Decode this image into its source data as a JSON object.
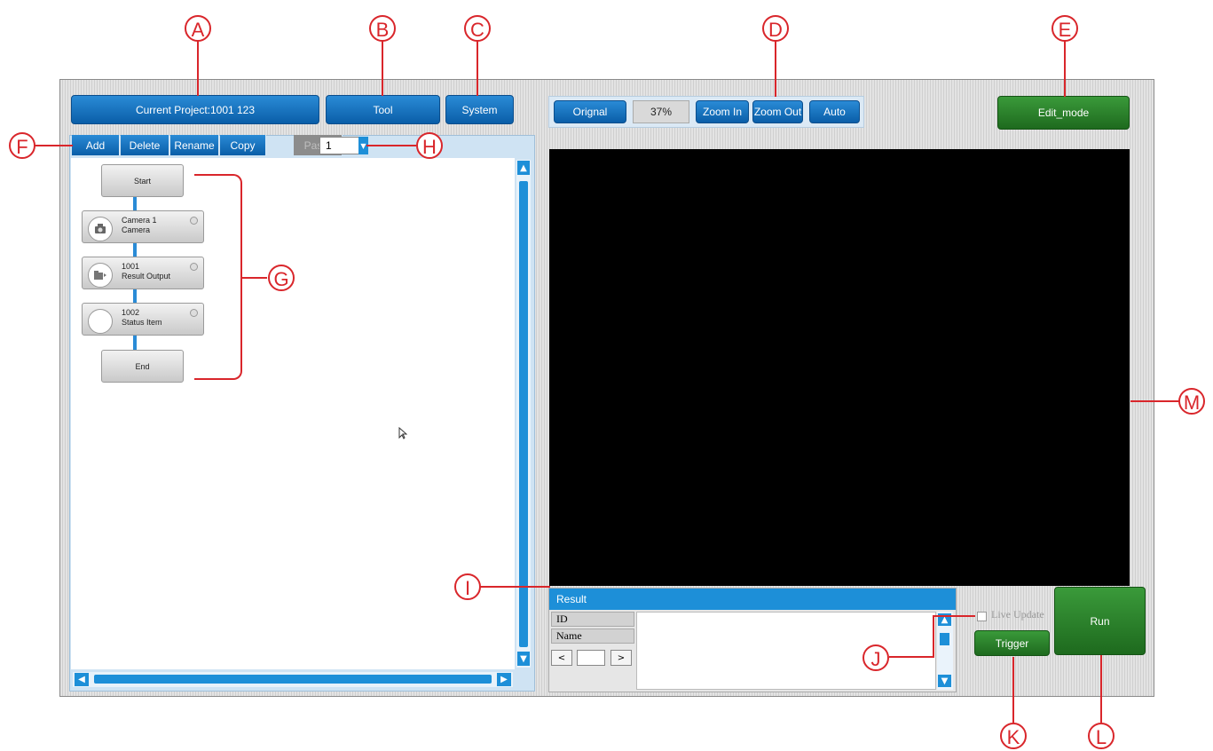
{
  "callouts": {
    "a": "A",
    "b": "B",
    "c": "C",
    "d": "D",
    "e": "E",
    "f": "F",
    "g": "G",
    "h": "H",
    "i": "I",
    "j": "J",
    "k": "K",
    "l": "L",
    "m": "M"
  },
  "header": {
    "project_label": "Current Project:1001 123",
    "tool_label": "Tool",
    "system_label": "System"
  },
  "zoom": {
    "original_label": "Orignal",
    "level": "37%",
    "zoom_in_label": "Zoom In",
    "zoom_out_label": "Zoom Out",
    "auto_label": "Auto"
  },
  "mode": {
    "edit_label": "Edit_mode"
  },
  "toolbar": {
    "add_label": "Add",
    "delete_label": "Delete",
    "rename_label": "Rename",
    "copy_label": "Copy",
    "paste_label": "Paste",
    "select_value": "1"
  },
  "flow": {
    "start_label": "Start",
    "end_label": "End",
    "items": [
      {
        "line1": "Camera 1",
        "line2": "Camera",
        "icon": "camera-icon"
      },
      {
        "line1": "1001",
        "line2": "Result Output",
        "icon": "folder-icon"
      },
      {
        "line1": "1002",
        "line2": "Status Item",
        "icon": "circle-icon"
      }
    ]
  },
  "result": {
    "title": "Result",
    "id_label": "ID",
    "name_label": "Name",
    "prev_label": "<",
    "next_label": ">"
  },
  "controls": {
    "live_update_label": "Live Update",
    "trigger_label": "Trigger",
    "run_label": "Run"
  },
  "colors": {
    "accent": "#0a5ea8",
    "callout": "#d9262b",
    "run": "#1e6a1e"
  }
}
